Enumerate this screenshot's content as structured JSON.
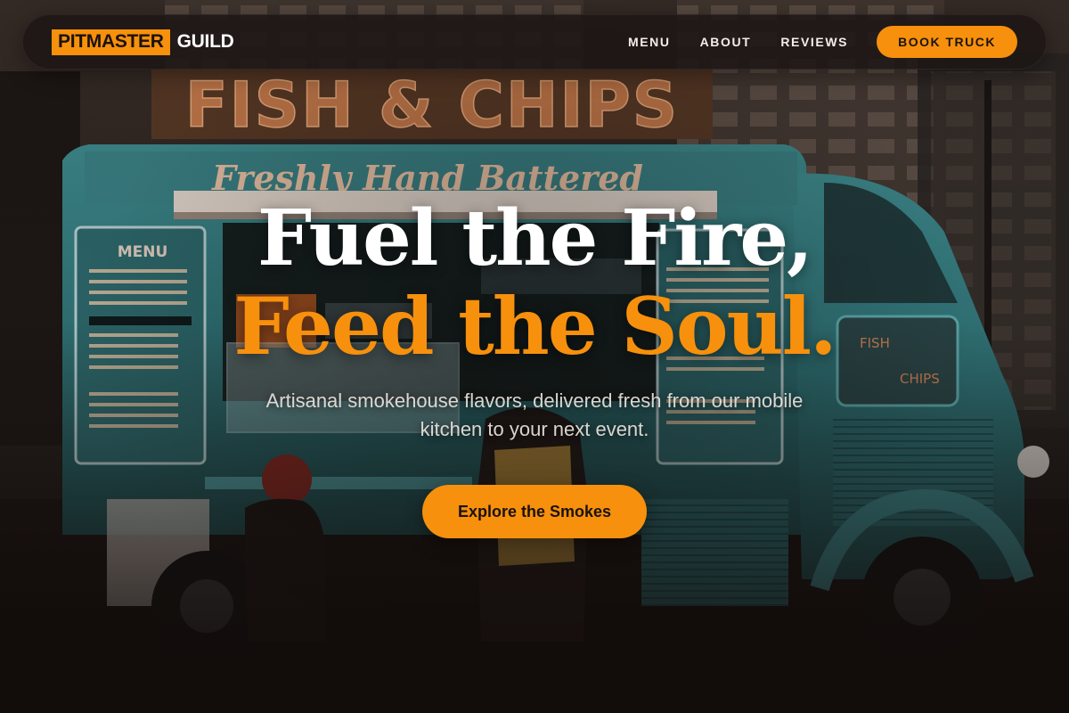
{
  "brand": {
    "name_accent": "PITMASTER",
    "name_rest": "GUILD",
    "accent_color": "#f7900c"
  },
  "nav": {
    "links": [
      "MENU",
      "ABOUT",
      "REVIEWS"
    ],
    "cta_label": "BOOK TRUCK"
  },
  "hero": {
    "headline_line1": "Fuel the Fire,",
    "headline_line2": "Feed the Soul.",
    "subtitle": "Artisanal smokehouse flavors, delivered fresh from our mobile kitchen to your next event.",
    "cta_label": "Explore the Smokes"
  },
  "background_signs": {
    "top_sign": "FISH & CHIPS",
    "truck_banner": "Freshly Hand Battered",
    "menu_board_title": "MENU"
  }
}
